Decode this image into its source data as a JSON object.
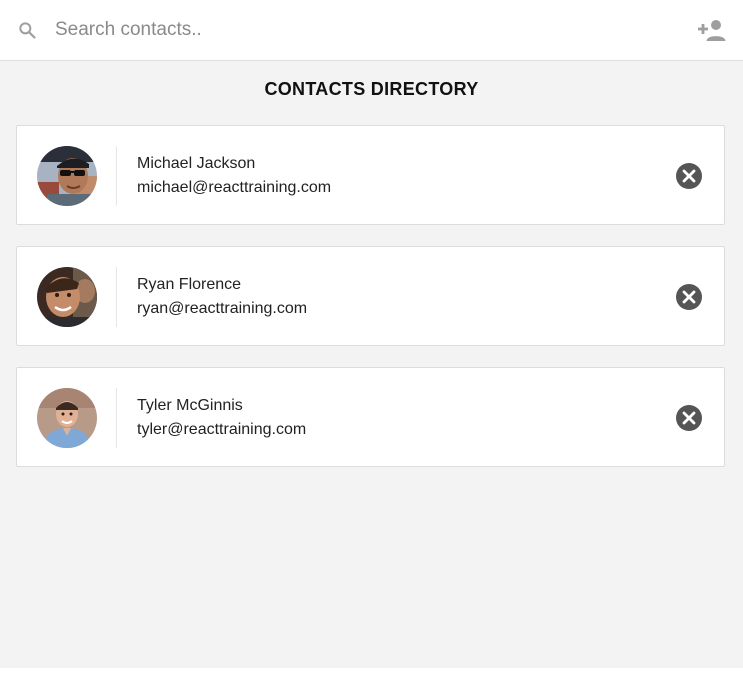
{
  "search": {
    "placeholder": "Search contacts.."
  },
  "header": {
    "add_icon": "person-add-icon",
    "search_icon": "search-icon"
  },
  "directory": {
    "title": "CONTACTS DIRECTORY"
  },
  "contacts": [
    {
      "name": "Michael Jackson",
      "email": "michael@reacttraining.com",
      "avatar": "avatar-photo",
      "remove_icon": "remove-circle-icon"
    },
    {
      "name": "Ryan Florence",
      "email": "ryan@reacttraining.com",
      "avatar": "avatar-photo",
      "remove_icon": "remove-circle-icon"
    },
    {
      "name": "Tyler McGinnis",
      "email": "tyler@reacttraining.com",
      "avatar": "avatar-photo",
      "remove_icon": "remove-circle-icon"
    }
  ],
  "colors": {
    "background": "#f3f3f3",
    "card": "#ffffff",
    "icon_gray": "#9e9e9e",
    "remove_gray": "#555555"
  }
}
